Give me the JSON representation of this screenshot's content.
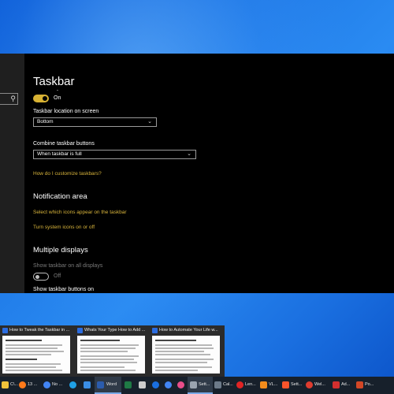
{
  "settings": {
    "page_title": "Taskbar",
    "toggle_on_label": "On",
    "location_label": "Taskbar location on screen",
    "location_value": "Bottom",
    "combine_label": "Combine taskbar buttons",
    "combine_value": "When taskbar is full",
    "customize_link": "How do I customize taskbars?",
    "notification_title": "Notification area",
    "select_icons_link": "Select which icons appear on the taskbar",
    "system_icons_link": "Turn system icons on or off",
    "multiple_title": "Multiple displays",
    "show_all_label": "Show taskbar on all displays",
    "toggle_off_label": "Off",
    "show_buttons_label": "Show taskbar buttons on"
  },
  "previews": [
    {
      "title": "How to Tweak the Taskbar in ..."
    },
    {
      "title": "Whats Your Type How to Add ..."
    },
    {
      "title": "How to Automate Your Life w..."
    }
  ],
  "taskbar": {
    "items": [
      {
        "name": "ci-app",
        "label": "C\\...",
        "color": "#f0c23a"
      },
      {
        "name": "firefox",
        "label": "13 ...",
        "color": "#ff7a1a"
      },
      {
        "name": "chrome",
        "label": "No ...",
        "color": "#4285f4"
      },
      {
        "name": "edge",
        "label": "",
        "color": "#1fa0e6"
      },
      {
        "name": "onedrive",
        "label": "",
        "color": "#3a8ee6"
      },
      {
        "name": "word",
        "label": "Word",
        "color": "#2b5cad"
      },
      {
        "name": "excel",
        "label": "",
        "color": "#1f7a45"
      },
      {
        "name": "terminal",
        "label": "",
        "color": "#cccccc"
      },
      {
        "name": "cortana",
        "label": "",
        "color": "#1a6fe0"
      },
      {
        "name": "chrome-2",
        "label": "",
        "color": "#4285f4"
      },
      {
        "name": "paint",
        "label": "",
        "color": "#e84e8a"
      },
      {
        "name": "settings",
        "label": "Sett...",
        "color": "#9aa4b0"
      },
      {
        "name": "calculator",
        "label": "Cal...",
        "color": "#6c7a89"
      },
      {
        "name": "lenovo",
        "label": "Len...",
        "color": "#e02424"
      },
      {
        "name": "vlc",
        "label": "VL...",
        "color": "#f28c1c"
      },
      {
        "name": "brave",
        "label": "Sett...",
        "color": "#fb542b"
      },
      {
        "name": "welcome",
        "label": "Wel...",
        "color": "#de3c2f"
      },
      {
        "name": "adobe",
        "label": "Ad...",
        "color": "#d32f2f"
      },
      {
        "name": "powerpoint",
        "label": "Po...",
        "color": "#d24726"
      }
    ]
  }
}
